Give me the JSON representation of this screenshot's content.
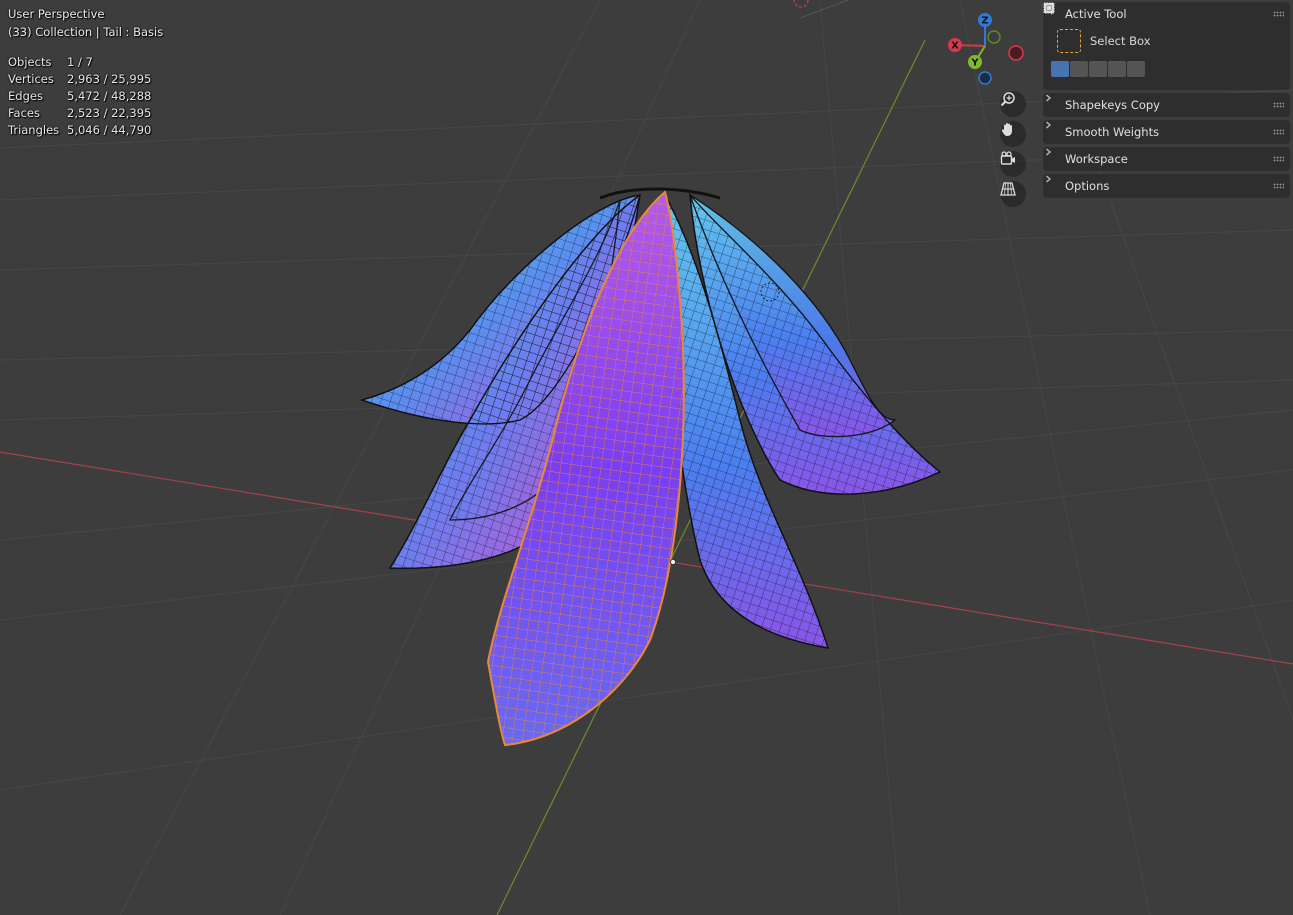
{
  "viewport": {
    "view_name": "User Perspective",
    "collection_info": "(33) Collection | Tail : Basis",
    "stats": [
      {
        "label": "Objects",
        "value": "1 / 7"
      },
      {
        "label": "Vertices",
        "value": "2,963 / 25,995"
      },
      {
        "label": "Edges",
        "value": "5,472 / 48,288"
      },
      {
        "label": "Faces",
        "value": "2,523 / 22,395"
      },
      {
        "label": "Triangles",
        "value": "5,046 / 44,790"
      }
    ]
  },
  "gizmo": {
    "axes": [
      {
        "label": "Z",
        "color": "#2f7bd9"
      },
      {
        "label": "X",
        "color": "#d8394e"
      },
      {
        "label": "Y",
        "color": "#7dbb2a"
      }
    ]
  },
  "nav_buttons": [
    {
      "name": "zoom",
      "icon": "zoom-icon"
    },
    {
      "name": "pan",
      "icon": "hand-icon"
    },
    {
      "name": "camera",
      "icon": "camera-icon"
    },
    {
      "name": "perspective",
      "icon": "grid-icon"
    }
  ],
  "sidebar": {
    "active_tool": {
      "title": "Active Tool",
      "tool_label": "Select Box"
    },
    "panels": [
      {
        "title": "Shapekeys Copy"
      },
      {
        "title": "Smooth Weights"
      },
      {
        "title": "Workspace"
      },
      {
        "title": "Options"
      }
    ]
  },
  "colors": {
    "background": "#3d3d3d",
    "grid": "#474747",
    "x_axis": "#a8404a",
    "y_axis": "#6a8f2a",
    "selection": "#e8883a",
    "panel": "#2e2e2e",
    "active_mode": "#4772b3"
  }
}
